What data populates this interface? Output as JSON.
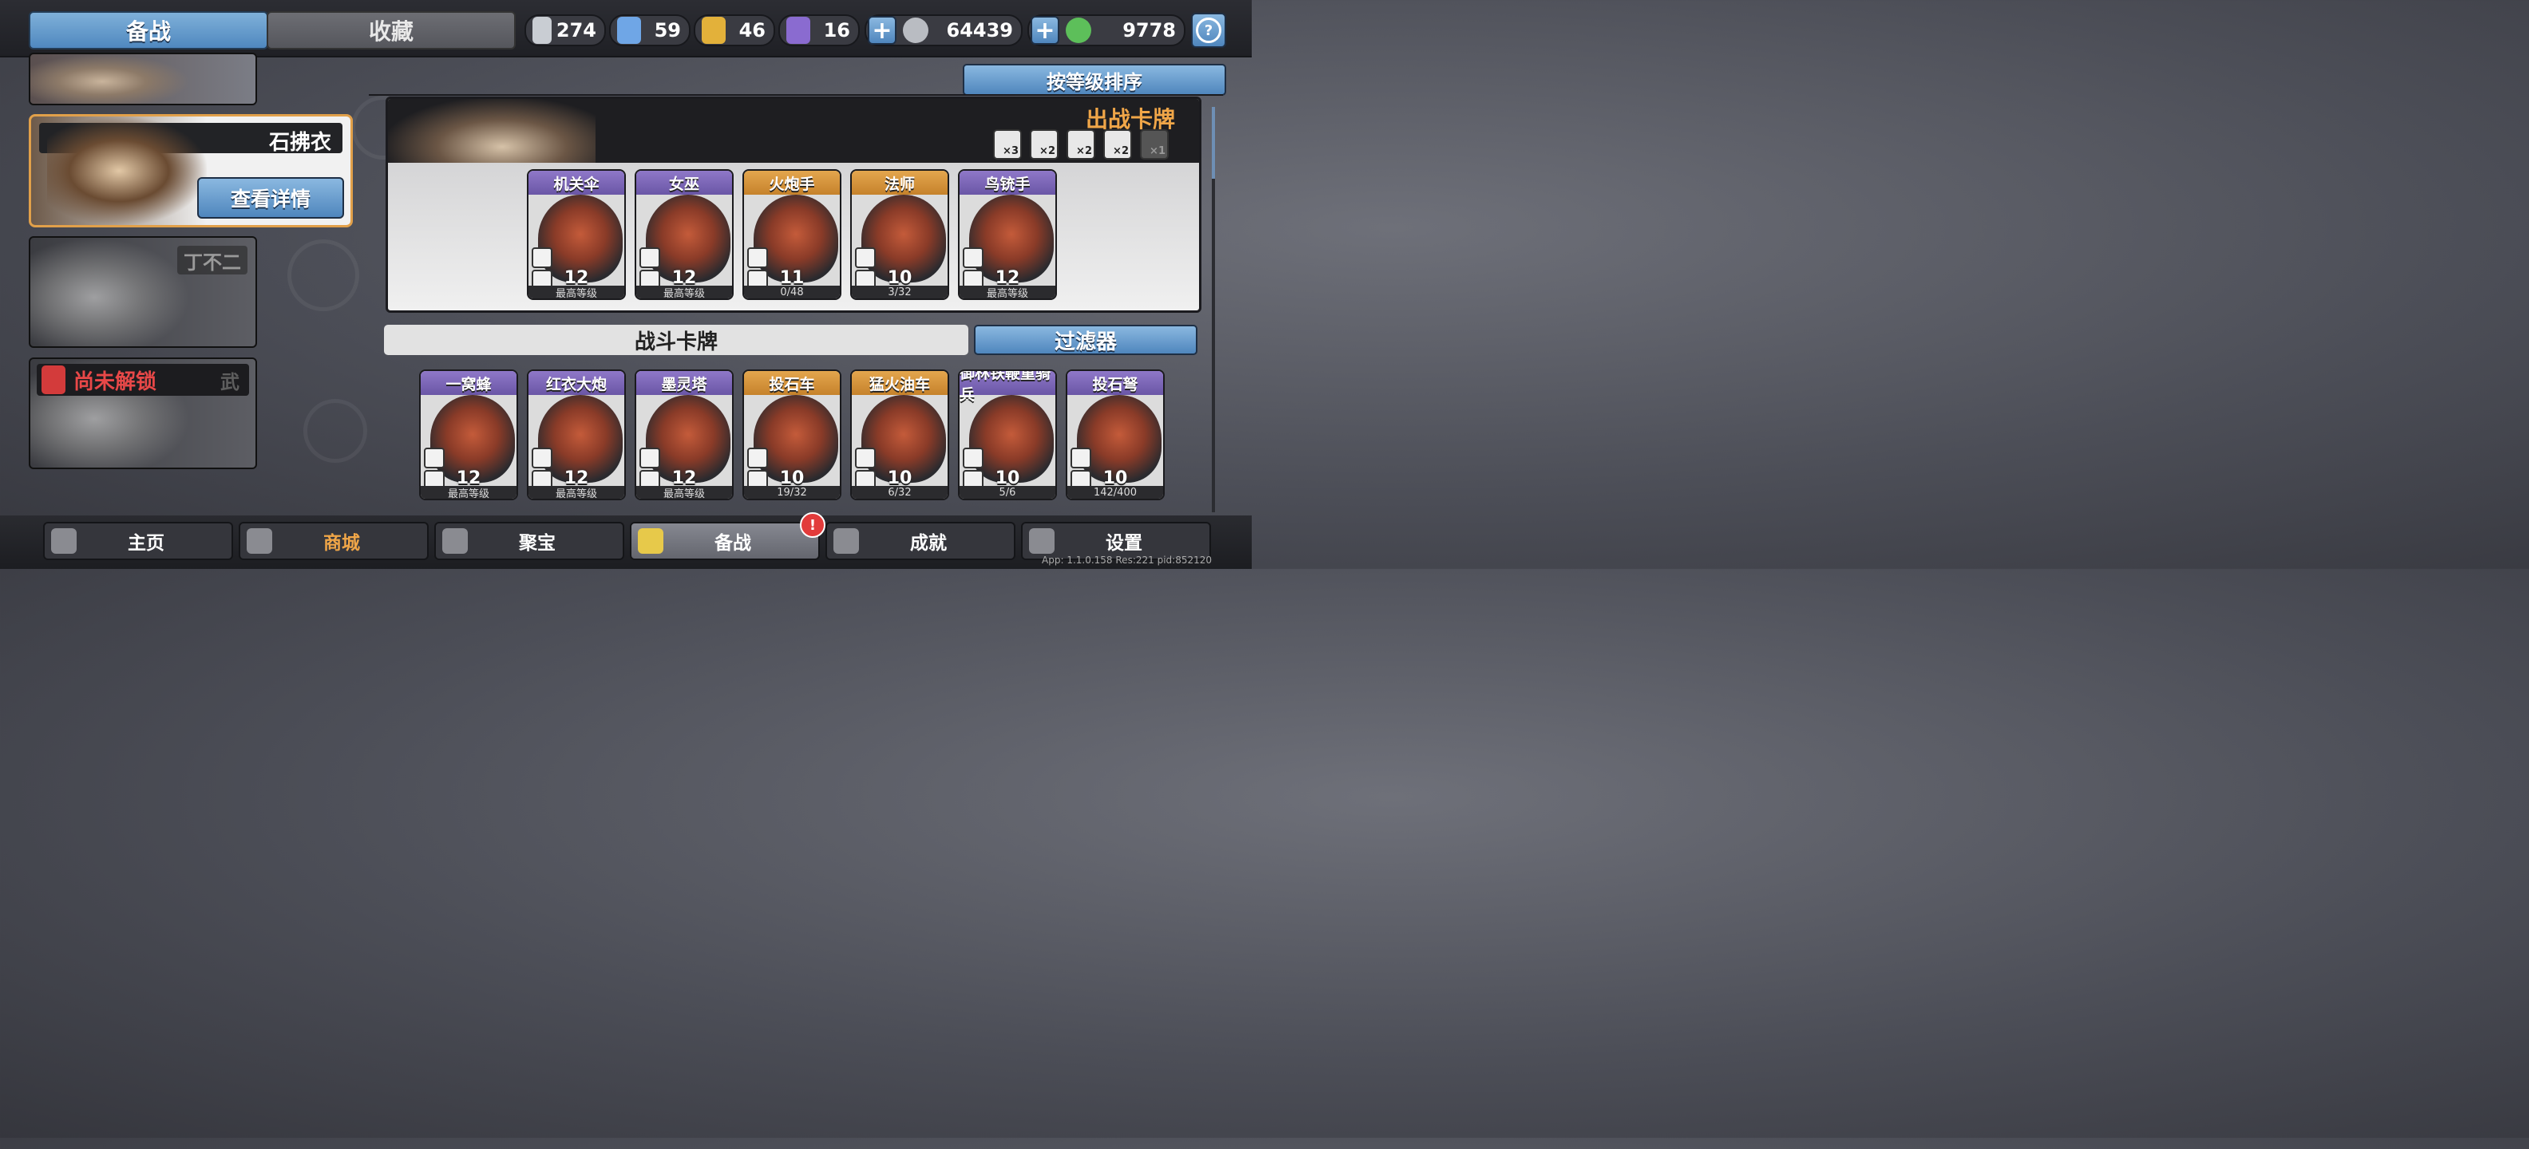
{
  "top": {
    "tab_active": "备战",
    "tab_inactive": "收藏",
    "resources": [
      {
        "icon": "silver-shield-icon",
        "value": "274",
        "color": "#c9cdd3"
      },
      {
        "icon": "blue-crystal-icon",
        "value": "59",
        "color": "#6fa6e6"
      },
      {
        "icon": "gold-shield-icon",
        "value": "46",
        "color": "#e3b13a"
      },
      {
        "icon": "purple-crystal-icon",
        "value": "16",
        "color": "#8a6bd0"
      }
    ],
    "coin_value": "64439",
    "jade_value": "9778"
  },
  "heroes": {
    "selected_name": "石拂衣",
    "detail_button": "查看详情",
    "hero3_name": "丁不二",
    "locked_text": "尚未解锁",
    "locked_suffix": "武"
  },
  "sort_button": "按等级排序",
  "deck": {
    "title": "出战卡牌",
    "traits": [
      "×3",
      "×2",
      "×2",
      "×2",
      "×1"
    ],
    "cards": [
      {
        "name": "机关伞",
        "level": "12",
        "foot": "最高等级",
        "rarity": "purple"
      },
      {
        "name": "女巫",
        "level": "12",
        "foot": "最高等级",
        "rarity": "purple"
      },
      {
        "name": "火炮手",
        "level": "11",
        "foot": "0/48",
        "rarity": "gold"
      },
      {
        "name": "法师",
        "level": "10",
        "foot": "3/32",
        "rarity": "gold"
      },
      {
        "name": "鸟铳手",
        "level": "12",
        "foot": "最高等级",
        "rarity": "purple"
      }
    ]
  },
  "battle": {
    "title": "战斗卡牌",
    "filter": "过滤器",
    "cards": [
      {
        "name": "一窝蜂",
        "level": "12",
        "foot": "最高等级",
        "rarity": "purple"
      },
      {
        "name": "红衣大炮",
        "level": "12",
        "foot": "最高等级",
        "rarity": "purple"
      },
      {
        "name": "墨灵塔",
        "level": "12",
        "foot": "最高等级",
        "rarity": "purple"
      },
      {
        "name": "投石车",
        "level": "10",
        "foot": "19/32",
        "rarity": "gold"
      },
      {
        "name": "猛火油车",
        "level": "10",
        "foot": "6/32",
        "rarity": "gold"
      },
      {
        "name": "御林铁鞭重骑兵",
        "level": "10",
        "foot": "5/6",
        "rarity": "purple"
      },
      {
        "name": "投石弩",
        "level": "10",
        "foot": "142/400",
        "rarity": "purple"
      }
    ]
  },
  "nav": [
    {
      "label": "主页",
      "icon": "home-icon"
    },
    {
      "label": "商城",
      "icon": "shop-icon"
    },
    {
      "label": "聚宝",
      "icon": "treasure-icon"
    },
    {
      "label": "备战",
      "icon": "deck-icon"
    },
    {
      "label": "成就",
      "icon": "achievement-icon"
    },
    {
      "label": "设置",
      "icon": "gear-icon"
    }
  ],
  "nav_badge": "!",
  "version": "App: 1.1.0.158 Res:221 pid:852120"
}
